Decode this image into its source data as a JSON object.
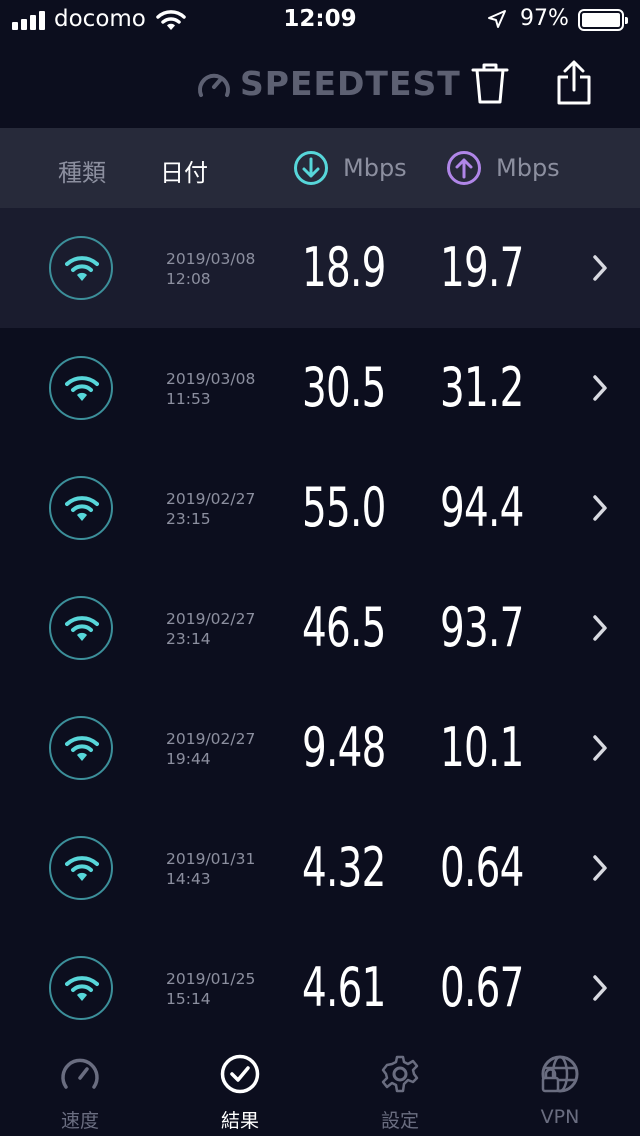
{
  "status_bar": {
    "carrier": "docomo",
    "time": "12:09",
    "battery": "97%"
  },
  "header": {
    "logo": "SPEEDTEST",
    "icons": [
      "speedometer-logo-icon",
      "trash-icon",
      "share-icon"
    ]
  },
  "columns": {
    "type": "種類",
    "date": "日付",
    "download_unit": "Mbps",
    "upload_unit": "Mbps",
    "download_color": "#57d6d9",
    "upload_color": "#b086e8"
  },
  "results": [
    {
      "date": "2019/03/08",
      "time": "12:08",
      "download": "18.9",
      "upload": "19.7",
      "selected": true
    },
    {
      "date": "2019/03/08",
      "time": "11:53",
      "download": "30.5",
      "upload": "31.2"
    },
    {
      "date": "2019/02/27",
      "time": "23:15",
      "download": "55.0",
      "upload": "94.4"
    },
    {
      "date": "2019/02/27",
      "time": "23:14",
      "download": "46.5",
      "upload": "93.7"
    },
    {
      "date": "2019/02/27",
      "time": "19:44",
      "download": "9.48",
      "upload": "10.1"
    },
    {
      "date": "2019/01/31",
      "time": "14:43",
      "download": "4.32",
      "upload": "0.64"
    },
    {
      "date": "2019/01/25",
      "time": "15:14",
      "download": "4.61",
      "upload": "0.67"
    }
  ],
  "tabs": [
    {
      "label": "速度",
      "icon": "speedometer-icon"
    },
    {
      "label": "結果",
      "icon": "checkmark-icon",
      "active": true
    },
    {
      "label": "設定",
      "icon": "gear-icon"
    },
    {
      "label": "VPN",
      "icon": "globe-lock-icon"
    }
  ]
}
